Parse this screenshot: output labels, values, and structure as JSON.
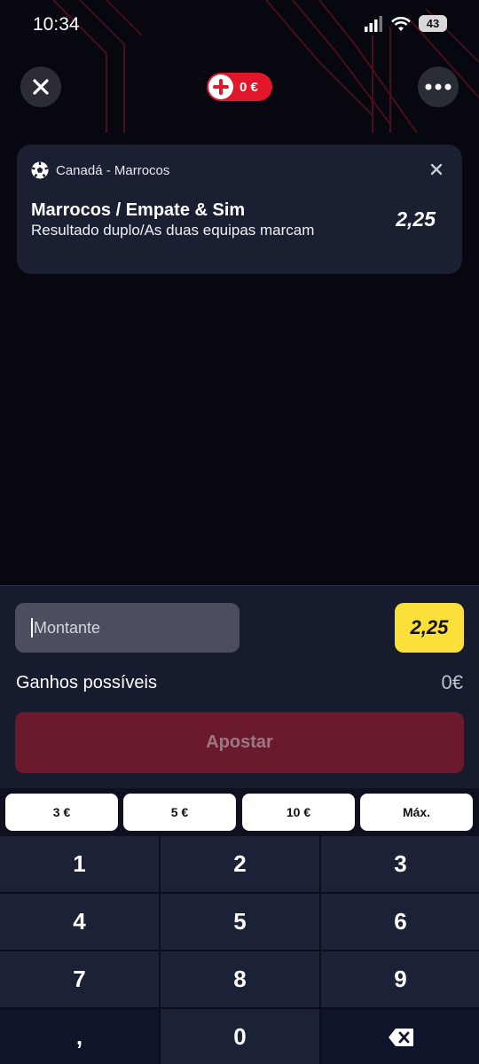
{
  "status_bar": {
    "time": "10:34",
    "battery": "43",
    "icons": [
      "signal-icon",
      "wifi-icon",
      "battery-icon"
    ]
  },
  "top_bar": {
    "close_icon": "close-icon",
    "balance": "0 €",
    "more_icon": "more-icon"
  },
  "bet_card": {
    "sport_icon": "soccer-ball-icon",
    "match": "Canadá - Marrocos",
    "selection": "Marrocos / Empate & Sim",
    "market": "Resultado duplo/As duas equipas marcam",
    "odds": "2,25",
    "remove_icon": "close-icon"
  },
  "bet_slip": {
    "amount_placeholder": "Montante",
    "total_odds": "2,25",
    "winnings_label": "Ganhos possíveis",
    "winnings_value": "0€",
    "bet_button": "Apostar",
    "quick_amounts": [
      "3 €",
      "5 €",
      "10 €",
      "Máx."
    ]
  },
  "keypad": {
    "keys": [
      "1",
      "2",
      "3",
      "4",
      "5",
      "6",
      "7",
      "8",
      "9",
      ",",
      "0"
    ],
    "backspace_icon": "backspace-icon"
  },
  "colors": {
    "background": "#06070f",
    "accent_red": "#e1162a",
    "odds_yellow": "#fbe03c",
    "bet_button_disabled": "#6b1a2e",
    "card": "#1b1f32"
  }
}
